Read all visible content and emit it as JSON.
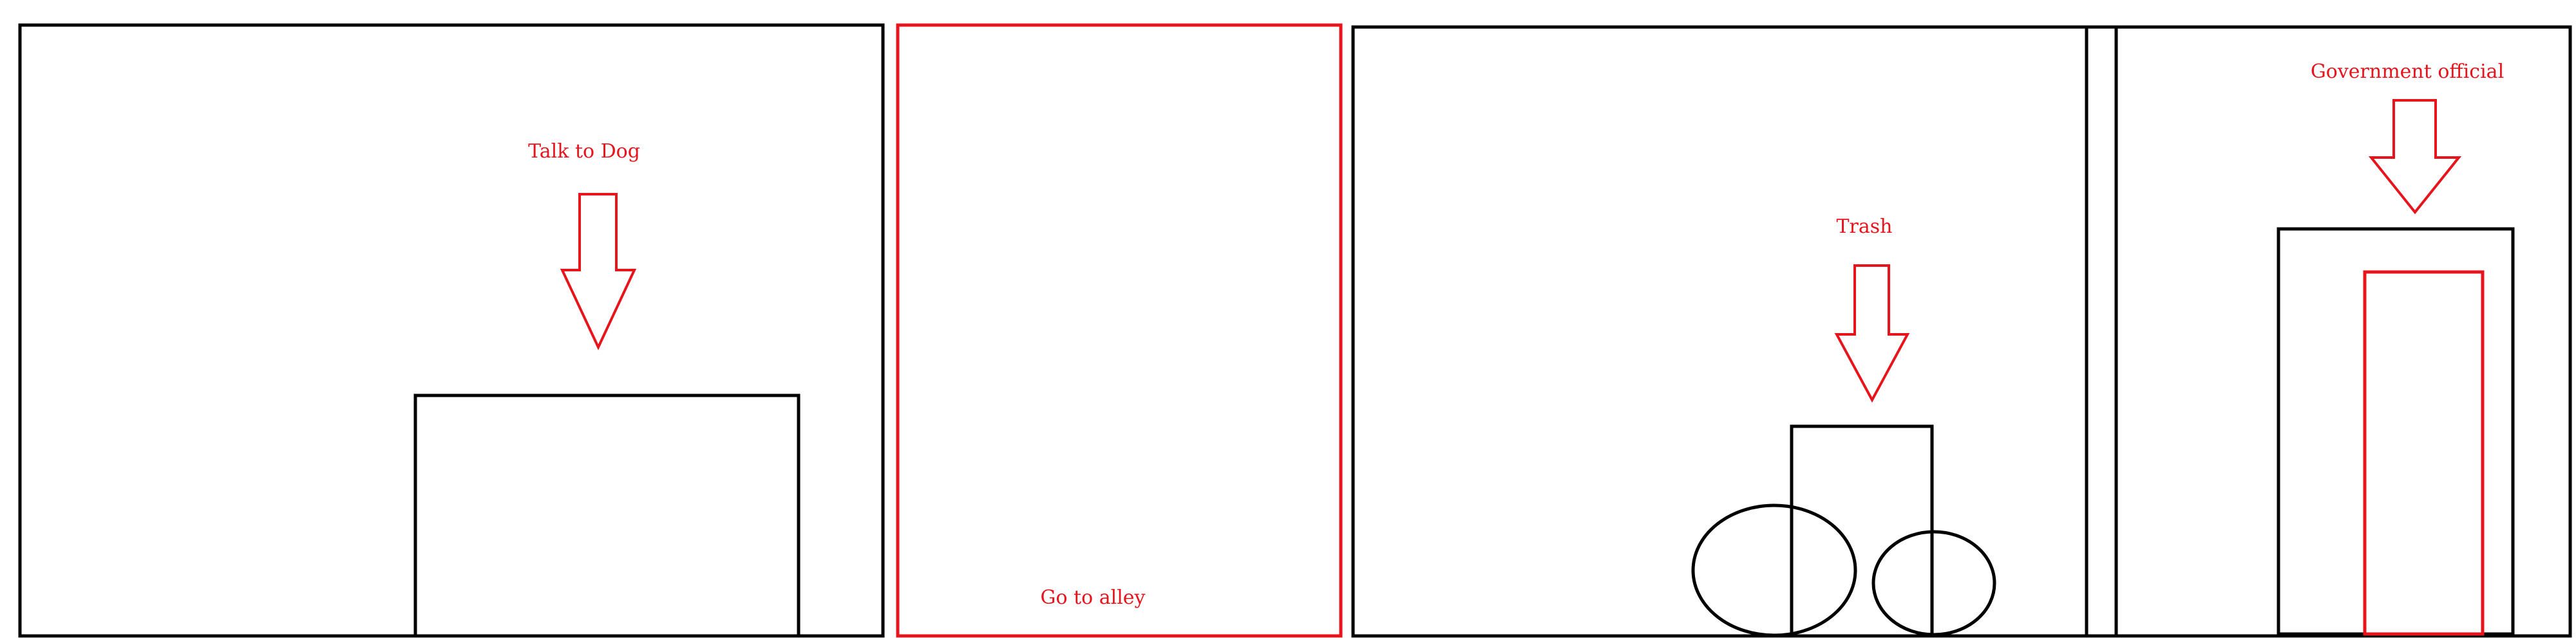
{
  "labels": {
    "talk_to_dog": "Talk to Dog",
    "go_to_alley": "Go to alley",
    "trash": "Trash",
    "government_official": "Government official"
  },
  "colors": {
    "outline": "#000000",
    "highlight": "#e8141c",
    "background": "#ffffff"
  }
}
